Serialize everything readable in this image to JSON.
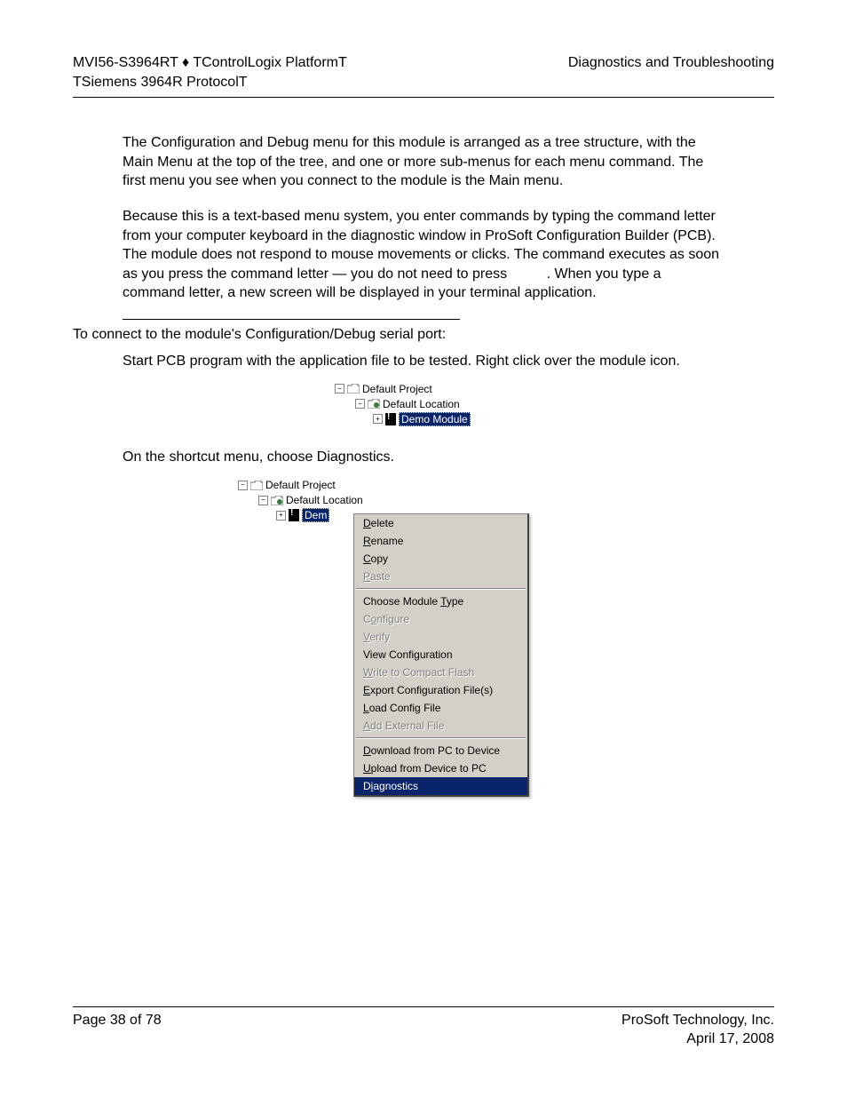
{
  "header": {
    "left_line1": "MVI56-S3964RT ♦ TControlLogix PlatformT",
    "left_line2": "TSiemens 3964R ProtocolT",
    "right": "Diagnostics and Troubleshooting"
  },
  "content": {
    "para1": "The Configuration and Debug menu for this module is arranged as a tree structure, with the Main Menu at the top of the tree, and one or more sub-menus for each menu command. The first menu you see when you connect to the module is the Main menu.",
    "para2_a": "Because this is a text-based menu system, you enter commands by typing the command letter from your computer keyboard in the diagnostic window in ProSoft Configuration Builder (PCB). The module does not respond to mouse movements or clicks. The command executes as soon as you press the command letter — you do not need to press ",
    "para2_b": ". When you type a command letter, a new screen will be displayed in your terminal application.",
    "connect_line": "To connect to the module's Configuration/Debug serial port:",
    "step1": "Start PCB program with the application file to be tested. Right click over the module icon.",
    "step2": "On the shortcut menu, choose Diagnostics."
  },
  "tree1": {
    "project": "Default Project",
    "location": "Default Location",
    "module": "Demo Module"
  },
  "tree2": {
    "project": "Default Project",
    "location": "Default Location",
    "module": "Dem",
    "menu": {
      "delete": "Delete",
      "rename": "Rename",
      "copy": "Copy",
      "paste": "Paste",
      "choose_type": "Choose Module Type",
      "configure": "Configure",
      "verify": "Verify",
      "view_config": "View Configuration",
      "write_cf": "Write to Compact Flash",
      "export_cfg": "Export Configuration File(s)",
      "load_cfg": "Load Config File",
      "add_ext": "Add External File",
      "download": "Download from PC to Device",
      "upload": "Upload from Device to PC",
      "diagnostics": "Diagnostics"
    }
  },
  "footer": {
    "left": "Page 38 of 78",
    "right_line1": "ProSoft Technology, Inc.",
    "right_line2": "April 17, 2008"
  }
}
